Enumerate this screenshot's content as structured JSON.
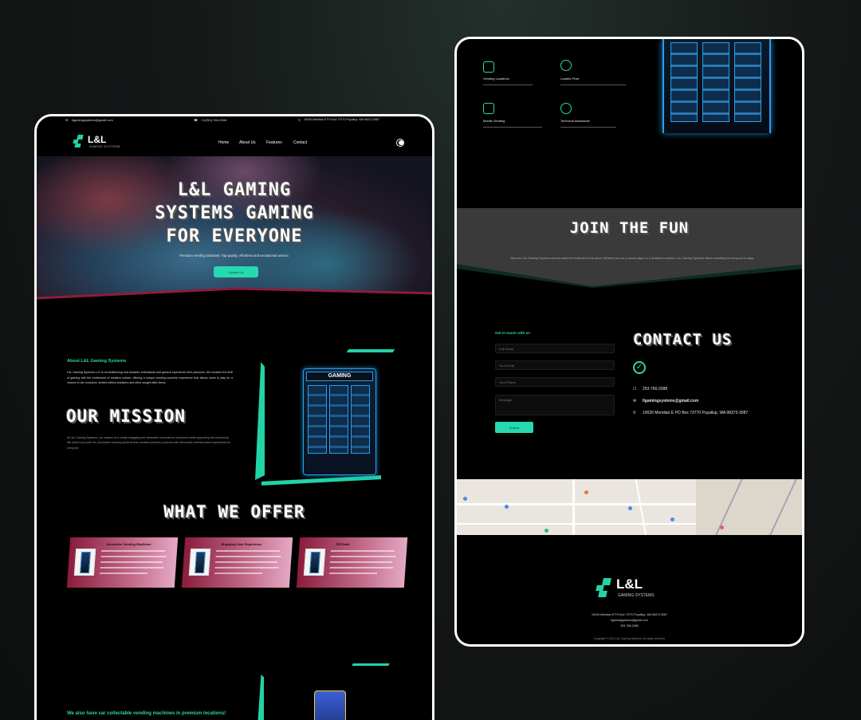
{
  "left_page": {
    "topbar": {
      "email": "llgamingsystems@gmail.com",
      "phone": "+1(253) 766-3388",
      "address": "10026 Meridian E PO Box 73770 Puyallup, WA 98373-3087"
    },
    "brand": {
      "name": "L&L",
      "tagline": "GAMING SYSTEMS"
    },
    "nav": [
      "Home",
      "About Us",
      "Features",
      "Contact"
    ],
    "hero": {
      "title_lines": [
        "L&L Gaming",
        "Systems Gaming",
        "For Everyone"
      ],
      "subtitle": "Premium vending solutions: Top-quality, effortless and exceptional service.",
      "cta": "Contact Us"
    },
    "about": {
      "heading": "About L&L Gaming Systems",
      "body": "L&L Gaming Systems LLC is revolutionizing how amateur enthusiasts and gamers experience their passions. We combine the thrill of gaming with the excitement of amateur culture, offering a unique vending machine experience that allows users to play for a chance to win exclusive, limited edition sneakers and other sought-after items."
    },
    "mission": {
      "heading": "Our Mission",
      "body": "At L&L Gaming Systems, our mission is to create engaging and interactive moments for customers while supporting the community. We strive to provide fun, innovative vending solutions that combine premium products with memorable entertainment experiences for everyone."
    },
    "offer": {
      "heading": "What We Offer",
      "cards": [
        {
          "title": "Innovative Vending Machines"
        },
        {
          "title": "Engaging User Experience"
        },
        {
          "title": "Nft Mode"
        }
      ]
    },
    "collectible": {
      "text": "We also have car collectable vending machines in premium locations!"
    }
  },
  "right_page": {
    "features": [
      {
        "title": "Vending Locations",
        "icon": "location-icon"
      },
      {
        "title": "Loaded Prize",
        "icon": "prize-icon"
      },
      {
        "title": "Mobile Vending",
        "icon": "truck-icon"
      },
      {
        "title": "Technical Assistance",
        "icon": "support-icon"
      }
    ],
    "join": {
      "heading": "Join The Fun",
      "body": "Step into L&L Gaming Systems and see what the excitement is all about. Whether you are a casual player or a dedicated collector, L&L Gaming Systems offers something for everyone to enjoy."
    },
    "contact_form": {
      "heading": "Get in touch with us",
      "fields": [
        "Full Name",
        "Your Email",
        "Your Phone",
        "Message"
      ],
      "submit": "Submit"
    },
    "contact_info": {
      "heading": "Contact Us",
      "phone": "253-766-3388",
      "email": "llgamingsystems@gmail.com",
      "address": "10026 Meridian E PO Box 73770 Puyallup, WA 98373-3087"
    },
    "footer": {
      "brand": "L&L",
      "tagline": "GAMING SYSTEMS",
      "address": "10026 Meridian E PO Box 73770 Puyallup, WA 98373-3087",
      "email": "llgamingsystems@gmail.com",
      "phone": "253-766-3388",
      "copyright": "Copyright © 2024 L&L Gaming Systems. All rights reserved."
    }
  },
  "colors": {
    "accent": "#22d3a6",
    "background": "#000000",
    "card_start": "#8a1c3c",
    "card_end": "#e4a9c4"
  }
}
